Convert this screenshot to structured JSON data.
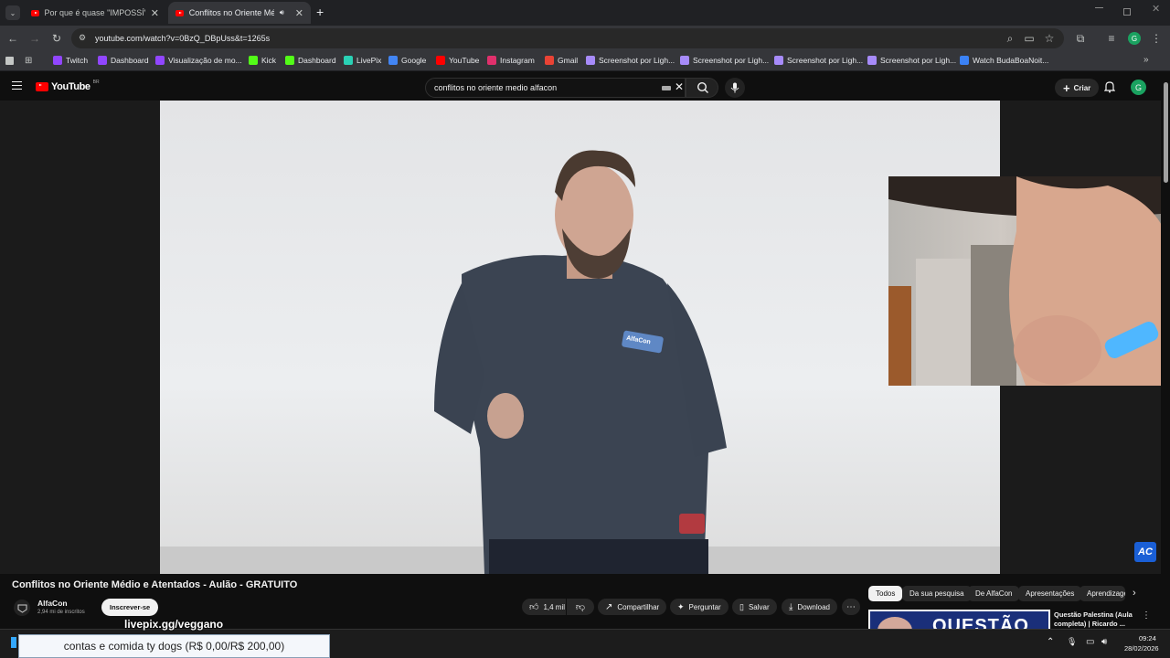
{
  "tabs": [
    {
      "title": "Por que é quase \"IMPOSSÍVEL\"",
      "active": false
    },
    {
      "title": "Conflitos no Oriente Médio",
      "active": true
    }
  ],
  "browser": {
    "url": "youtube.com/watch?v=0BzQ_DBpUss&t=1265s",
    "new_tab": "+",
    "profile_initial": "G"
  },
  "bookmarks": [
    {
      "label": "Twitch",
      "color": "#9146ff"
    },
    {
      "label": "Dashboard",
      "color": "#9146ff"
    },
    {
      "label": "Visualização de mo...",
      "color": "#9146ff"
    },
    {
      "label": "Kick",
      "color": "#53fc18"
    },
    {
      "label": "Dashboard",
      "color": "#53fc18"
    },
    {
      "label": "LivePix",
      "color": "#2ad1b5"
    },
    {
      "label": "Google",
      "color": "#4285f4"
    },
    {
      "label": "YouTube",
      "color": "#ff0000"
    },
    {
      "label": "Instagram",
      "color": "#e1306c"
    },
    {
      "label": "Gmail",
      "color": "#ea4335"
    },
    {
      "label": "Screenshot por Ligh...",
      "color": "#a78bfa"
    },
    {
      "label": "Screenshot por Ligh...",
      "color": "#a78bfa"
    },
    {
      "label": "Screenshot por Ligh...",
      "color": "#a78bfa"
    },
    {
      "label": "Screenshot por Ligh...",
      "color": "#a78bfa"
    },
    {
      "label": "Watch BudaBoaNoit...",
      "color": "#3b82f6"
    }
  ],
  "youtube": {
    "logo": "YouTube",
    "logo_region": "BR",
    "search_query": "conflitos no oriente medio alfacon",
    "create_label": "Criar",
    "avatar_initial": "G"
  },
  "video": {
    "title": "Conflitos no Oriente Médio e Atentados - Aulão - GRATUITO",
    "channel": "AlfaCon",
    "subscribers": "2,94 mi de inscritos",
    "subscribe_label": "Inscrever-se",
    "likes": "1,4 mil",
    "share_label": "Compartilhar",
    "ask_label": "Perguntar",
    "save_label": "Salvar",
    "download_label": "Download",
    "watermark": "AC",
    "shirt_logo": "AlfaCon"
  },
  "chips": [
    "Todos",
    "Da sua pesquisa",
    "De AlfaCon",
    "Apresentações",
    "Aprendizagem"
  ],
  "recommendation": {
    "title": "Questão Palestina (Aula completa) | Ricardo ...",
    "thumb_text": "QUESTÃO"
  },
  "overlay": {
    "livepix_url": "livepix.gg/veggano",
    "goal_text": "contas e comida ty dogs (R$ 0,00/R$ 200,00)"
  },
  "taskbar": {
    "time": "09:24",
    "date": "28/02/2026"
  }
}
